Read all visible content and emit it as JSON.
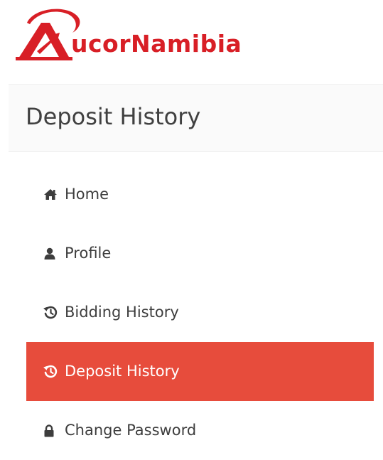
{
  "brand": {
    "name_part1": "ucor",
    "name_part2": "Namibia",
    "color": "#d81f26"
  },
  "page": {
    "title": "Deposit History"
  },
  "menu": {
    "items": [
      {
        "label": "Home",
        "icon": "home-icon",
        "active": false
      },
      {
        "label": "Profile",
        "icon": "user-icon",
        "active": false
      },
      {
        "label": "Bidding History",
        "icon": "history-icon",
        "active": false
      },
      {
        "label": "Deposit History",
        "icon": "history-icon",
        "active": true
      },
      {
        "label": "Change Password",
        "icon": "lock-icon",
        "active": false
      }
    ],
    "active_color": "#e74c3c"
  }
}
